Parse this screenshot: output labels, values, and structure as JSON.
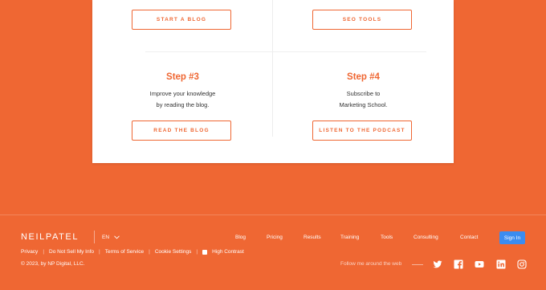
{
  "card": {
    "top_buttons": [
      "START A BLOG",
      "SEO TOOLS"
    ],
    "steps": [
      {
        "title": "Step #3",
        "lines": [
          "Improve your knowledge",
          "by reading the blog."
        ],
        "button": "READ THE BLOG"
      },
      {
        "title": "Step #4",
        "lines": [
          "Subscribe to",
          "Marketing School."
        ],
        "button": "LISTEN TO THE PODCAST"
      }
    ]
  },
  "footer": {
    "logo": "NEILPATEL",
    "language": "EN",
    "nav": [
      "Blog",
      "Pricing",
      "Results",
      "Training",
      "Tools",
      "Consulting",
      "Contact"
    ],
    "sign_in": "Sign In",
    "links": [
      "Privacy",
      "Do Not Sell My Info",
      "Terms of Service",
      "Cookie Settings"
    ],
    "high_contrast": "High Contrast",
    "copyright": "© 2023, by NP Digital, LLC.",
    "follow": "Follow me around the web",
    "social_icons": [
      "twitter-icon",
      "facebook-icon",
      "youtube-icon",
      "linkedin-icon",
      "instagram-icon"
    ]
  },
  "colors": {
    "brand": "#ef6733",
    "signin": "#3b8cf0"
  }
}
